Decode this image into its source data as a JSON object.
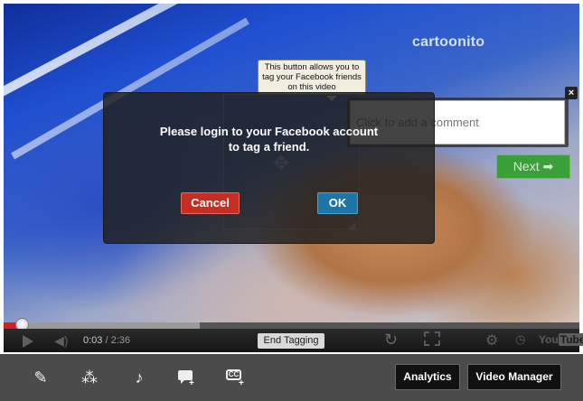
{
  "video": {
    "channel_logo": "cartoonito",
    "tooltip_text": "This button allows you to tag your Facebook friends on this video",
    "comment": {
      "placeholder": "Click to add a comment",
      "close_label": "×"
    },
    "next_label": "Next ➡"
  },
  "modal": {
    "message_line1": "Please login to your Facebook account",
    "message_line2": "to tag a friend.",
    "cancel_label": "Cancel",
    "ok_label": "OK"
  },
  "player": {
    "progress": 0.034,
    "buffered": 0.34,
    "time_current": "0:03",
    "time_separator": " / ",
    "time_total": "2:36",
    "end_tagging_label": "End Tagging",
    "youtube_label_1": "You",
    "youtube_label_2": "Tube"
  },
  "toolbar": {
    "icons": [
      "pencil-icon",
      "magic-wand-icon",
      "music-note-icon",
      "add-comment-icon",
      "add-captions-icon"
    ],
    "cc_label": "CC",
    "analytics_label": "Analytics",
    "video_manager_label": "Video Manager"
  },
  "colors": {
    "progress_red": "#d61f1f",
    "cancel_red": "#c62d23",
    "ok_blue": "#1e76a7",
    "next_green": "#2f9f28",
    "toolbar_gray": "#4b4b4b"
  }
}
